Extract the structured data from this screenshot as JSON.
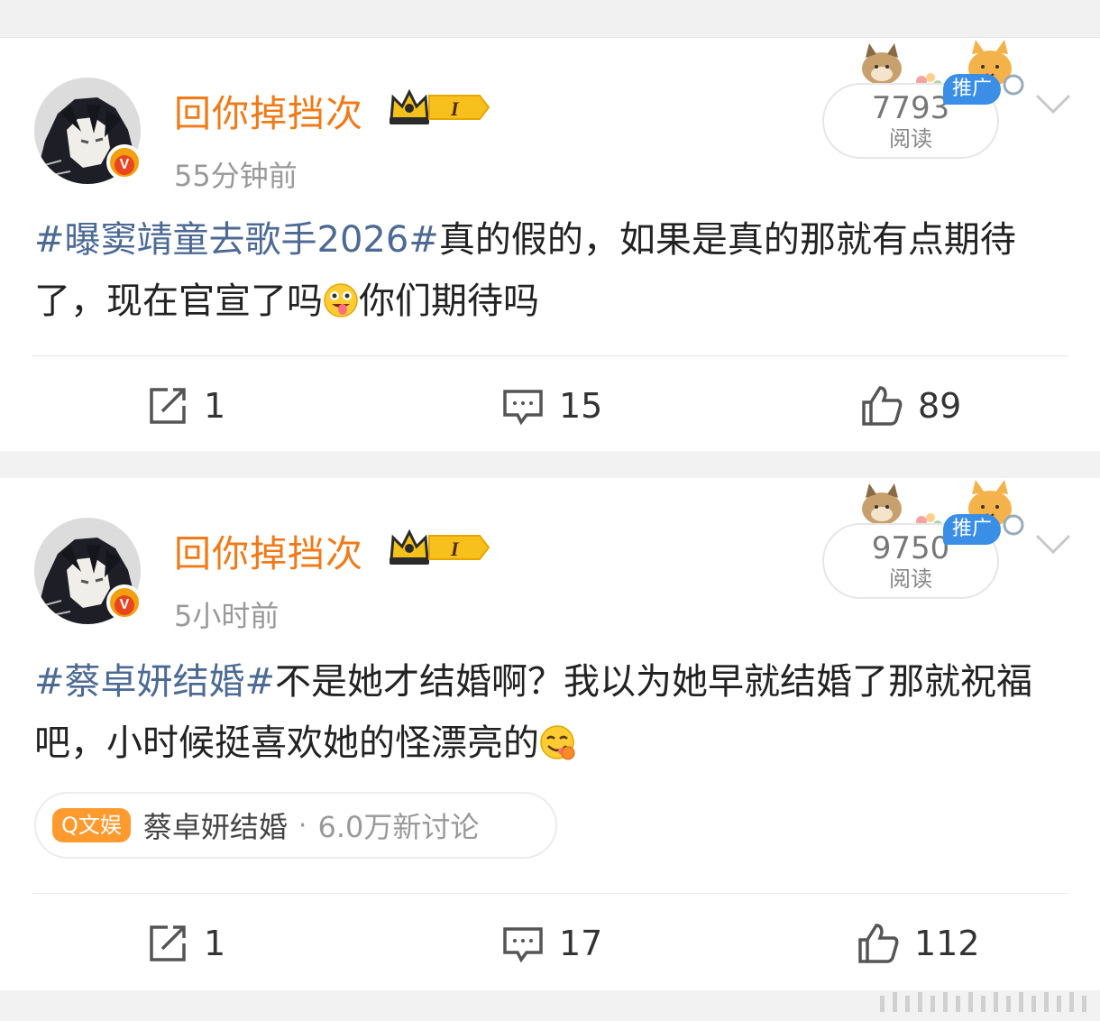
{
  "posts": [
    {
      "username": "回你掉挡次",
      "time": "55分钟前",
      "reads_count": "7793",
      "reads_label": "阅读",
      "promo_label": "推广",
      "content": {
        "topic": "#曝窦靖童去歌手2026#",
        "text_a": "真的假的，如果是真的那就有点期待了，现在官宣了吗",
        "emoji": "drooling-face-emoji",
        "text_b": "你们期待吗"
      },
      "actions": {
        "repost": "1",
        "comment": "15",
        "like": "89"
      }
    },
    {
      "username": "回你掉挡次",
      "time": "5小时前",
      "reads_count": "9750",
      "reads_label": "阅读",
      "promo_label": "推广",
      "content": {
        "topic": "#蔡卓妍结婚#",
        "text_a": "不是她才结婚啊？我以为她早就结婚了那就祝福吧，小时候挺喜欢她的怪漂亮的",
        "emoji": "face-savoring-food-emoji"
      },
      "topic_chip": {
        "tag": "Q文娱",
        "name": "蔡卓妍结婚",
        "separator": "·",
        "count": "6.0万新讨论"
      },
      "actions": {
        "repost": "1",
        "comment": "17",
        "like": "112"
      }
    }
  ],
  "icons": {
    "repost": "repost-icon",
    "comment": "comment-icon",
    "like": "thumbs-up-icon",
    "more": "chevron-down-icon",
    "verified": "verified-v-badge-icon",
    "vip": "crown-vip-badge-icon"
  },
  "colors": {
    "username": "#f07a18",
    "topic": "#4c6a94",
    "promo": "#3a8ee6",
    "chip_tag": "#ff9a2e",
    "text": "#222222",
    "muted": "#999999"
  }
}
